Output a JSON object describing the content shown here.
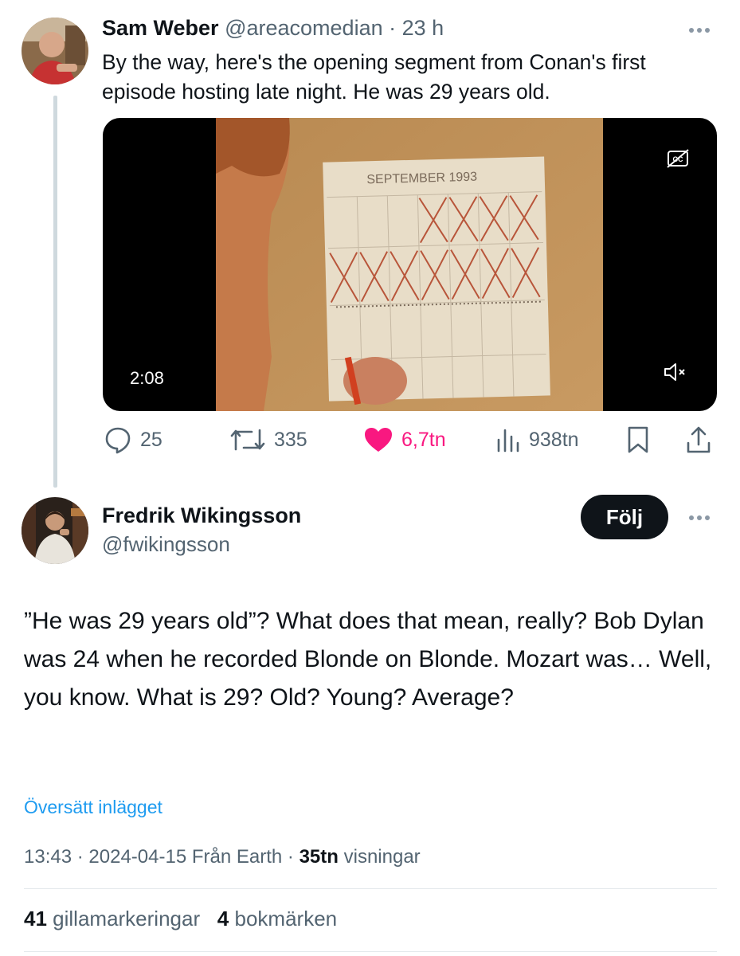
{
  "tweet1": {
    "author_name": "Sam Weber",
    "handle": "@areacomedian",
    "separator": "·",
    "time": "23 h",
    "text_line1": "By the way, here's the opening segment from Conan's first",
    "text_line2": "episode  hosting late night. He was 29 years old.",
    "video": {
      "duration": "2:08",
      "calendar_title": "SEPTEMBER 1993"
    },
    "actions": {
      "replies": "25",
      "reposts": "335",
      "likes": "6,7tn",
      "views": "938tn"
    }
  },
  "tweet2": {
    "author_name": "Fredrik Wikingsson",
    "handle": "@fwikingsson",
    "follow_label": "Följ",
    "text": "”He was 29 years old”? What does that mean, really? Bob Dylan was 24 when he recorded Blonde on Blonde. Mozart was… Well, you know. What is 29? Old? Young? Average?",
    "translate_label": "Översätt inlägget",
    "meta": {
      "time": "13:43",
      "date": "2024-04-15",
      "source": "Från Earth",
      "views_count": "35tn",
      "views_label": "visningar",
      "sep": "·"
    },
    "stats": {
      "likes_count": "41",
      "likes_label": "gillamarkeringar",
      "bookmarks_count": "4",
      "bookmarks_label": "bokmärken"
    }
  },
  "colors": {
    "like_pink": "#f91880",
    "link_blue": "#1d9bf0",
    "muted_gray": "#536471",
    "text_dark": "#0f1419"
  },
  "icons": [
    "more-icon",
    "reply-icon",
    "repost-icon",
    "like-icon",
    "views-icon",
    "bookmark-icon",
    "share-icon",
    "captions-off-icon",
    "volume-muted-icon"
  ]
}
